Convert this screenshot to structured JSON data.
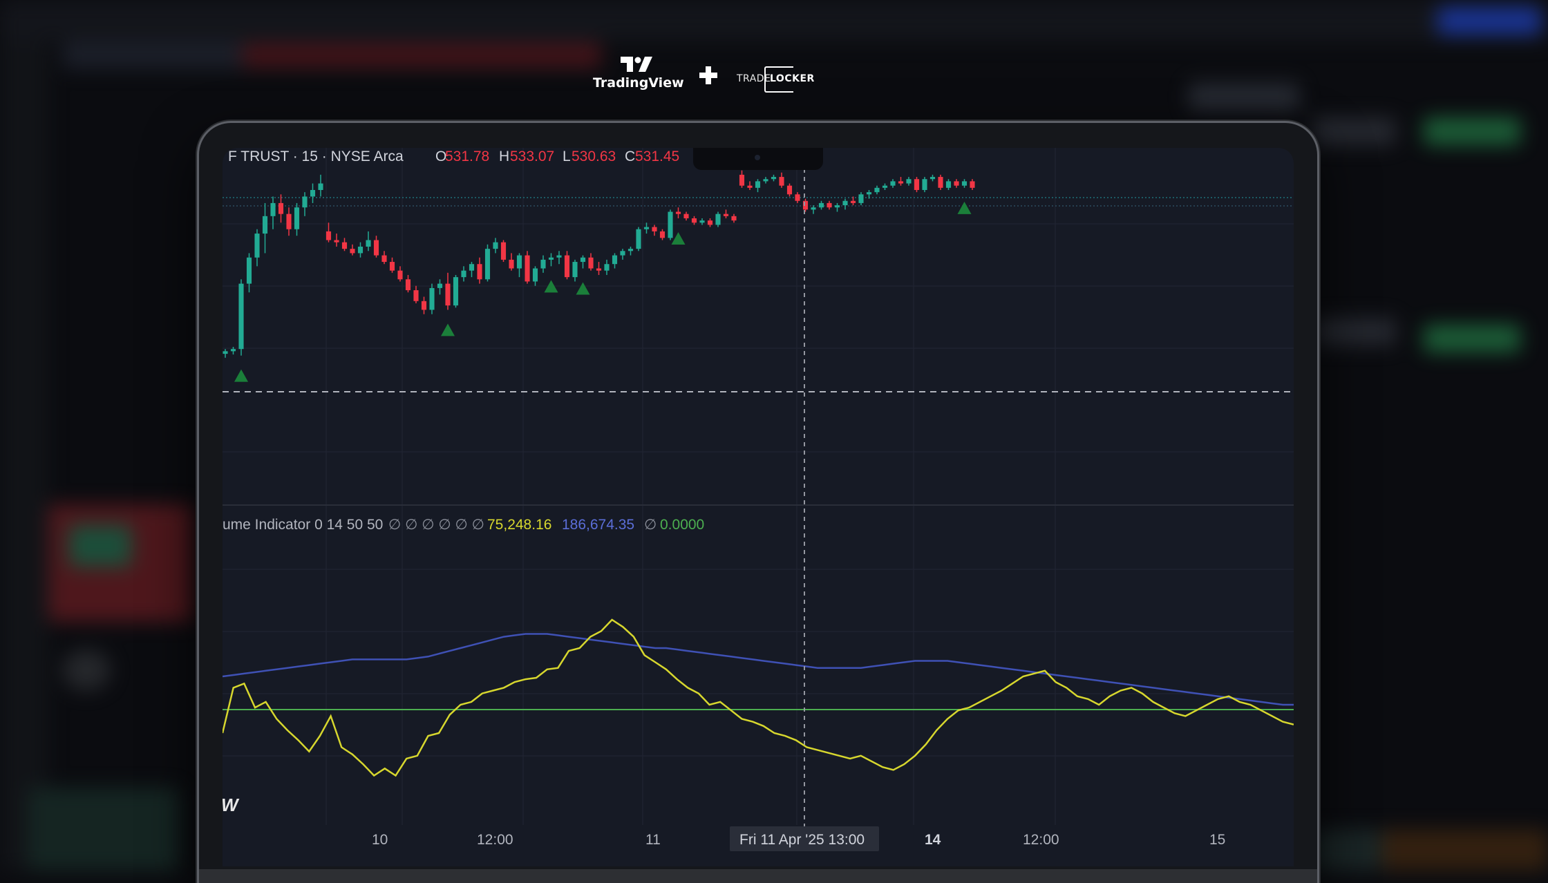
{
  "brand": {
    "tradingview": "TradingView",
    "tradelocker_a": "TRADE",
    "tradelocker_b": "LOCKER",
    "plus_icon": "plus-icon",
    "colors": {
      "text": "#ffffff",
      "background": "#0b0c10"
    }
  },
  "chart": {
    "symbol_label": "F TRUST · 15 · NYSE Arca",
    "ohlc": [
      {
        "key": "O",
        "value": "531.78"
      },
      {
        "key": "H",
        "value": "533.07"
      },
      {
        "key": "L",
        "value": "530.63"
      },
      {
        "key": "C",
        "value": "531.45"
      }
    ],
    "indicator_label": "ume Indicator 0 14 50 50",
    "indicator_placeholders": "∅ ∅ ∅ ∅ ∅ ∅",
    "indicator_values": [
      {
        "value": "75,248.16",
        "color": "#d7d72e"
      },
      {
        "value": "186,674.35",
        "color": "#5b6ed8"
      },
      {
        "value": "∅",
        "color": "#8a8e99"
      },
      {
        "value": "0.0000",
        "color": "#4caf50"
      }
    ],
    "x_axis_labels": [
      "10",
      "12:00",
      "11",
      "14",
      "12:00",
      "15"
    ],
    "crosshair_label": "Fri 11 Apr '25   13:00",
    "watermark": "W",
    "colors": {
      "background": "#161a25",
      "up": "#22ab94",
      "down": "#f23645",
      "oscillator": "#d7d72e",
      "average": "#3f51b5",
      "zero_line": "#4caf50",
      "signal_marker": "#1b7f3a"
    }
  },
  "chart_data": {
    "type": "candlestick",
    "candles": [
      [
        531.78,
        532.0,
        531.6,
        531.9
      ],
      [
        531.9,
        532.1,
        531.75,
        532.0
      ],
      [
        532.0,
        535.2,
        531.7,
        535.0
      ],
      [
        535.0,
        536.4,
        534.6,
        536.2
      ],
      [
        536.2,
        537.5,
        535.8,
        537.3
      ],
      [
        537.3,
        538.7,
        536.4,
        538.1
      ],
      [
        538.1,
        539.0,
        537.5,
        538.7
      ],
      [
        538.7,
        539.1,
        537.8,
        538.2
      ],
      [
        538.2,
        538.5,
        537.2,
        537.5
      ],
      [
        537.5,
        538.7,
        537.2,
        538.5
      ],
      [
        538.5,
        539.2,
        538.1,
        539.0
      ],
      [
        539.0,
        539.6,
        538.7,
        539.3
      ],
      [
        539.3,
        540.0,
        539.0,
        539.6
      ],
      [
        537.4,
        537.8,
        536.9,
        537.0
      ],
      [
        537.0,
        537.3,
        536.7,
        536.9
      ],
      [
        536.9,
        537.1,
        536.5,
        536.6
      ],
      [
        536.6,
        536.8,
        536.3,
        536.4
      ],
      [
        536.4,
        536.9,
        536.2,
        536.7
      ],
      [
        536.7,
        537.4,
        536.5,
        537.0
      ],
      [
        537.0,
        537.2,
        536.2,
        536.3
      ],
      [
        536.3,
        536.5,
        535.9,
        536.0
      ],
      [
        536.0,
        536.2,
        535.5,
        535.6
      ],
      [
        535.6,
        535.8,
        535.1,
        535.2
      ],
      [
        535.2,
        535.4,
        534.6,
        534.7
      ],
      [
        534.7,
        534.9,
        534.1,
        534.2
      ],
      [
        534.2,
        534.4,
        533.6,
        533.8
      ],
      [
        533.8,
        535.0,
        533.6,
        534.8
      ],
      [
        534.8,
        535.2,
        534.5,
        535.0
      ],
      [
        535.0,
        535.5,
        533.8,
        534.0
      ],
      [
        534.0,
        535.4,
        533.9,
        535.3
      ],
      [
        535.3,
        535.8,
        535.1,
        535.6
      ],
      [
        535.6,
        536.0,
        535.3,
        535.9
      ],
      [
        535.9,
        536.2,
        535.0,
        535.2
      ],
      [
        535.2,
        536.8,
        535.1,
        536.6
      ],
      [
        536.6,
        537.1,
        536.4,
        536.9
      ],
      [
        536.9,
        537.0,
        536.0,
        536.1
      ],
      [
        536.1,
        536.4,
        535.6,
        535.7
      ],
      [
        535.7,
        536.4,
        535.3,
        536.3
      ],
      [
        536.3,
        536.5,
        535.0,
        535.1
      ],
      [
        535.1,
        535.8,
        534.9,
        535.7
      ],
      [
        535.7,
        536.3,
        535.5,
        536.1
      ],
      [
        536.1,
        536.4,
        535.8,
        536.2
      ],
      [
        536.2,
        536.5,
        535.9,
        536.3
      ],
      [
        536.3,
        536.5,
        535.2,
        535.3
      ],
      [
        535.3,
        536.1,
        535.1,
        536.0
      ],
      [
        536.0,
        536.3,
        535.7,
        536.2
      ],
      [
        536.2,
        536.4,
        535.6,
        535.7
      ],
      [
        535.7,
        536.0,
        535.4,
        535.6
      ],
      [
        535.6,
        536.1,
        535.4,
        535.9
      ],
      [
        535.9,
        536.4,
        535.7,
        536.3
      ],
      [
        536.3,
        536.6,
        536.1,
        536.5
      ],
      [
        536.5,
        536.7,
        536.3,
        536.6
      ],
      [
        536.6,
        537.6,
        536.5,
        537.5
      ],
      [
        537.5,
        537.8,
        537.3,
        537.6
      ],
      [
        537.6,
        537.7,
        537.2,
        537.4
      ],
      [
        537.4,
        537.5,
        537.0,
        537.1
      ],
      [
        537.1,
        538.4,
        537.0,
        538.3
      ],
      [
        538.3,
        538.5,
        538.0,
        538.2
      ],
      [
        538.2,
        538.3,
        537.9,
        538.0
      ],
      [
        538.0,
        538.1,
        537.7,
        537.8
      ],
      [
        537.8,
        538.0,
        537.7,
        537.9
      ],
      [
        537.9,
        538.0,
        537.6,
        537.7
      ],
      [
        537.7,
        538.3,
        537.6,
        538.2
      ],
      [
        538.2,
        538.4,
        538.0,
        538.1
      ],
      [
        538.1,
        538.2,
        537.8,
        537.9
      ],
      [
        540.0,
        540.2,
        539.4,
        539.5
      ],
      [
        539.5,
        539.7,
        539.3,
        539.4
      ],
      [
        539.4,
        539.8,
        539.2,
        539.7
      ],
      [
        539.7,
        539.9,
        539.6,
        539.8
      ],
      [
        539.8,
        540.0,
        539.7,
        539.9
      ],
      [
        539.9,
        540.1,
        539.4,
        539.5
      ],
      [
        539.5,
        539.6,
        539.0,
        539.1
      ],
      [
        539.1,
        539.2,
        538.7,
        538.8
      ],
      [
        538.8,
        538.9,
        538.3,
        538.4
      ],
      [
        538.4,
        538.6,
        538.2,
        538.5
      ],
      [
        538.5,
        538.8,
        538.4,
        538.7
      ],
      [
        538.7,
        538.8,
        538.4,
        538.5
      ],
      [
        538.5,
        538.7,
        538.3,
        538.6
      ],
      [
        538.6,
        538.9,
        538.4,
        538.8
      ],
      [
        538.8,
        539.0,
        538.6,
        538.7
      ],
      [
        538.7,
        539.2,
        538.6,
        539.1
      ],
      [
        539.1,
        539.3,
        538.9,
        539.2
      ],
      [
        539.2,
        539.5,
        539.1,
        539.4
      ],
      [
        539.4,
        539.6,
        539.3,
        539.5
      ],
      [
        539.5,
        539.8,
        539.4,
        539.7
      ],
      [
        539.7,
        539.9,
        539.5,
        539.6
      ],
      [
        539.6,
        539.9,
        539.5,
        539.8
      ],
      [
        539.8,
        539.9,
        539.2,
        539.3
      ],
      [
        539.3,
        539.9,
        539.2,
        539.8
      ],
      [
        539.8,
        540.0,
        539.7,
        539.9
      ],
      [
        539.9,
        540.0,
        539.3,
        539.4
      ],
      [
        539.4,
        539.8,
        539.3,
        539.7
      ],
      [
        539.7,
        539.8,
        539.4,
        539.5
      ],
      [
        539.5,
        539.8,
        539.4,
        539.7
      ],
      [
        539.7,
        539.8,
        539.3,
        539.4
      ]
    ],
    "price_range": [
      529.5,
      540.6
    ],
    "signal_markers": [
      2,
      28,
      41,
      45,
      57,
      93
    ],
    "oscillator": [
      60,
      92,
      95,
      78,
      82,
      70,
      62,
      55,
      47,
      58,
      72,
      50,
      45,
      38,
      30,
      35,
      30,
      42,
      44,
      58,
      60,
      73,
      80,
      82,
      88,
      90,
      92,
      96,
      98,
      99,
      105,
      106,
      118,
      120,
      128,
      132,
      140,
      135,
      128,
      115,
      110,
      105,
      98,
      92,
      88,
      80,
      82,
      76,
      70,
      68,
      65,
      60,
      58,
      55,
      50,
      48,
      46,
      44,
      42,
      44,
      40,
      36,
      34,
      38,
      44,
      52,
      62,
      70,
      76,
      78,
      82,
      86,
      90,
      95,
      100,
      102,
      104,
      96,
      92,
      86,
      84,
      80,
      86,
      90,
      92,
      88,
      82,
      78,
      74,
      72,
      76,
      80,
      84,
      86,
      82,
      80,
      76,
      72,
      68,
      66
    ],
    "average_line": [
      100,
      101,
      102,
      103,
      104,
      105,
      106,
      107,
      108,
      109,
      110,
      111,
      112,
      112,
      112,
      112,
      112,
      112,
      113,
      114,
      116,
      118,
      120,
      122,
      124,
      126,
      128,
      129,
      130,
      130,
      130,
      129,
      128,
      127,
      126,
      125,
      124,
      123,
      122,
      121,
      120,
      120,
      119,
      118,
      117,
      116,
      115,
      114,
      113,
      112,
      111,
      110,
      109,
      108,
      107,
      106,
      106,
      106,
      106,
      106,
      107,
      108,
      109,
      110,
      111,
      111,
      111,
      111,
      110,
      109,
      108,
      107,
      106,
      105,
      104,
      103,
      102,
      101,
      100,
      99,
      98,
      97,
      96,
      95,
      94,
      93,
      92,
      91,
      90,
      89,
      88,
      87,
      86,
      85,
      84,
      83,
      82,
      81,
      80,
      80
    ],
    "oscillator_range": [
      0,
      200
    ],
    "zero_value": 56
  }
}
